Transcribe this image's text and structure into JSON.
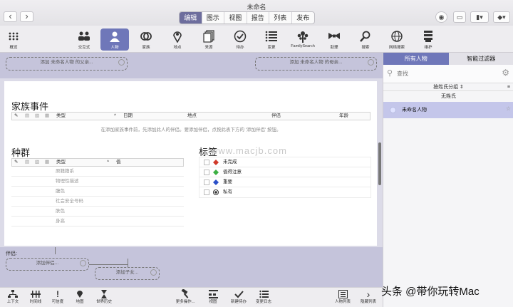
{
  "window": {
    "title": "未命名"
  },
  "mode_tabs": [
    {
      "label": "编辑",
      "active": true
    },
    {
      "label": "图示"
    },
    {
      "label": "视图"
    },
    {
      "label": "报告"
    },
    {
      "label": "列表"
    },
    {
      "label": "发布"
    }
  ],
  "toolbar": [
    {
      "label": "概览",
      "icon": "grid-icon"
    },
    {
      "label": "交互式",
      "icon": "people-icon"
    },
    {
      "label": "人物",
      "icon": "person-icon",
      "active": true
    },
    {
      "label": "家族",
      "icon": "rings-icon"
    },
    {
      "label": "地点",
      "icon": "pin-icon"
    },
    {
      "label": "来源",
      "icon": "documents-icon"
    },
    {
      "label": "待办",
      "icon": "check-circle-icon"
    },
    {
      "label": "变更",
      "icon": "list-icon"
    },
    {
      "label": "FamilySearch",
      "icon": "tree-icon"
    },
    {
      "label": "助理",
      "icon": "bowtie-icon"
    },
    {
      "label": "搜索",
      "icon": "magnifier-icon"
    },
    {
      "label": "网络搜索",
      "icon": "globe-icon"
    },
    {
      "label": "维护",
      "icon": "maintenance-icon"
    }
  ],
  "parents": {
    "father": "添加 未命名人物 的父亲...",
    "mother": "添加 未命名人物 的母亲..."
  },
  "family_events": {
    "title": "家族事件",
    "columns": [
      "类型",
      "日期",
      "地点",
      "伴侣",
      "年龄"
    ],
    "empty_message": "在添加家族事件前，先添加此人的伴侣。要添加伴侣，点按此表下方的 '添加伴侣' 按钮。"
  },
  "race": {
    "title": "种群",
    "columns": [
      "类型",
      "值"
    ],
    "rows": [
      "原籍籍系",
      "物理性描述",
      "腹色",
      "社会安全号码",
      "肤色",
      "身高"
    ]
  },
  "tags": {
    "title": "标签",
    "items": [
      {
        "label": "未完成",
        "color": "#d03a2a"
      },
      {
        "label": "值得注意",
        "color": "#3cb043"
      },
      {
        "label": "重要",
        "color": "#2a4fc8"
      },
      {
        "label": "私有",
        "color": "#333333"
      }
    ]
  },
  "spouse": {
    "label": "伴侣:",
    "add_spouse": "添加伴侣...",
    "add_child": "添加子女..."
  },
  "bottom_left": [
    {
      "label": "上下文",
      "icon": "context-icon"
    },
    {
      "label": "时间线",
      "icon": "timeline-icon"
    },
    {
      "label": "可信度",
      "icon": "exclamation-icon"
    },
    {
      "label": "地图",
      "icon": "map-icon"
    },
    {
      "label": "世界历史",
      "icon": "hourglass-icon"
    }
  ],
  "bottom_right": [
    {
      "label": "更多操作...",
      "icon": "hammer-icon"
    },
    {
      "label": "视图",
      "icon": "view-icon"
    },
    {
      "label": "新建待办",
      "icon": "new-todo-icon"
    },
    {
      "label": "变更日志",
      "icon": "changelog-icon"
    }
  ],
  "person_list_btn": {
    "label": "人物列表",
    "icon": "person-list-icon"
  },
  "hide_list_btn": {
    "label": "隐藏列表",
    "icon": "chevron-right-icon"
  },
  "right_panel": {
    "tabs": [
      {
        "label": "所有人物",
        "active": true
      },
      {
        "label": "智能过滤器"
      }
    ],
    "search_placeholder": "查找",
    "group_by": "按姓氏分组",
    "group_name": "无姓氏",
    "persons": [
      "未命名人物"
    ]
  },
  "watermark": "www.macjb.com",
  "credit": "头条 @带你玩转Mac"
}
